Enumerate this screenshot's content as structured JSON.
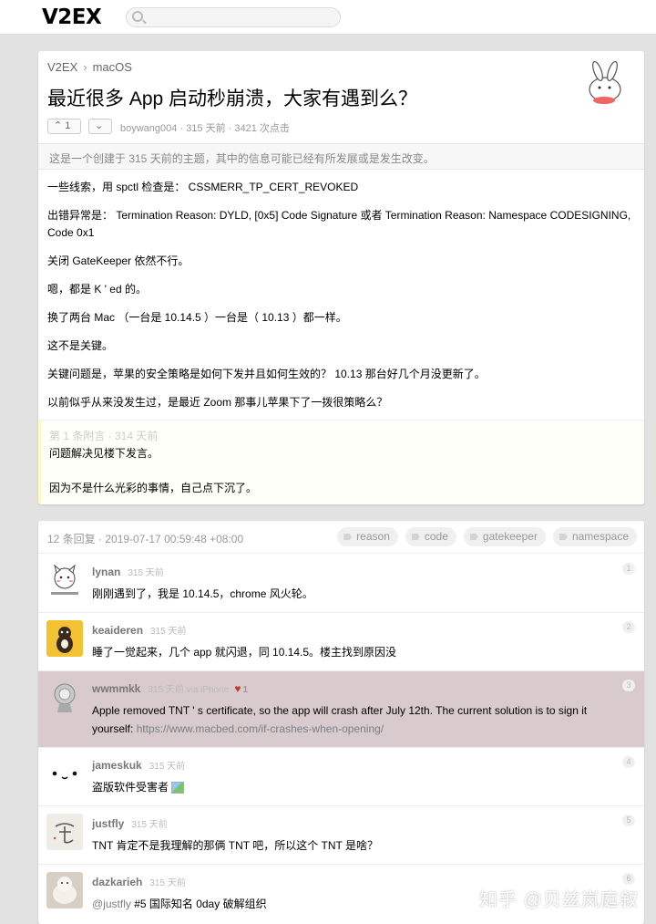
{
  "site": {
    "logo": "V2EX",
    "search_placeholder": ""
  },
  "topic": {
    "breadcrumb": {
      "home": "V2EX",
      "separator": "›",
      "node": "macOS"
    },
    "title": "最近很多 App 启动秒崩溃，大家有遇到么？",
    "votes": {
      "up_label": "1"
    },
    "meta": "boywang004 · 315 天前 · 3421 次点击",
    "notice": "这是一个创建于 315 天前的主题，其中的信息可能已经有所发展或是发生改变。",
    "content": [
      "一些线索，用 spctl 检查是： CSSMERR_TP_CERT_REVOKED",
      "出错异常是： Termination Reason: DYLD, [0x5] Code Signature 或者 Termination Reason: Namespace CODESIGNING, Code 0x1",
      "关闭 GateKeeper 依然不行。",
      "嗯，都是 K ' ed 的。",
      "换了两台 Mac （一台是 10.14.5 ）一台是（ 10.13 ）都一样。",
      "这不是关键。",
      "关键问题是，苹果的安全策略是如何下发并且如何生效的？ 10.13 那台好几个月没更新了。",
      "以前似乎从来没发生过，是最近 Zoom 那事儿苹果下了一拨很策略么？"
    ],
    "appendix": {
      "header": "第 1 条附言  ·  314 天前",
      "lines": [
        "问题解决见楼下发言。",
        "因为不是什么光彩的事情，自己点下沉了。"
      ]
    }
  },
  "replies_header": {
    "summary": "12 条回复  ·  2019-07-17 00:59:48 +08:00",
    "tags": [
      "reason",
      "code",
      "gatekeeper",
      "namespace"
    ]
  },
  "replies": [
    {
      "user": "lynan",
      "time": "315 天前",
      "no": "1",
      "text": "刚刚遇到了，我是 10.14.5，chrome 风火轮。"
    },
    {
      "user": "keaideren",
      "time": "315 天前",
      "no": "2",
      "text": "睡了一觉起来，几个 app 就闪退，同 10.14.5。楼主找到原因没"
    },
    {
      "user": "wwmmkk",
      "time": "315 天前 via iPhone",
      "likes": "1",
      "no": "3",
      "text": "Apple removed TNT ' s certificate, so the app will crash after July 12th. The current solution is to sign it yourself:",
      "link": "https://www.macbed.com/if-crashes-when-opening/"
    },
    {
      "user": "jameskuk",
      "time": "315 天前",
      "no": "4",
      "text": "盗版软件受害者"
    },
    {
      "user": "justfly",
      "time": "315 天前",
      "no": "5",
      "text": "TNT 肯定不是我理解的那俩 TNT 吧，所以这个 TNT 是啥？"
    },
    {
      "user": "dazkarieh",
      "time": "315 天前",
      "no": "6",
      "mention": "@justfly",
      "text": " #5 国际知名 0day 破解组织"
    }
  ],
  "watermark": "知乎 @贝兹岚庭叙",
  "colors": {
    "highlight_reply": "#d9cbcd",
    "appendix_bg": "#fffff9",
    "page_bg": "#e2e2e2"
  }
}
